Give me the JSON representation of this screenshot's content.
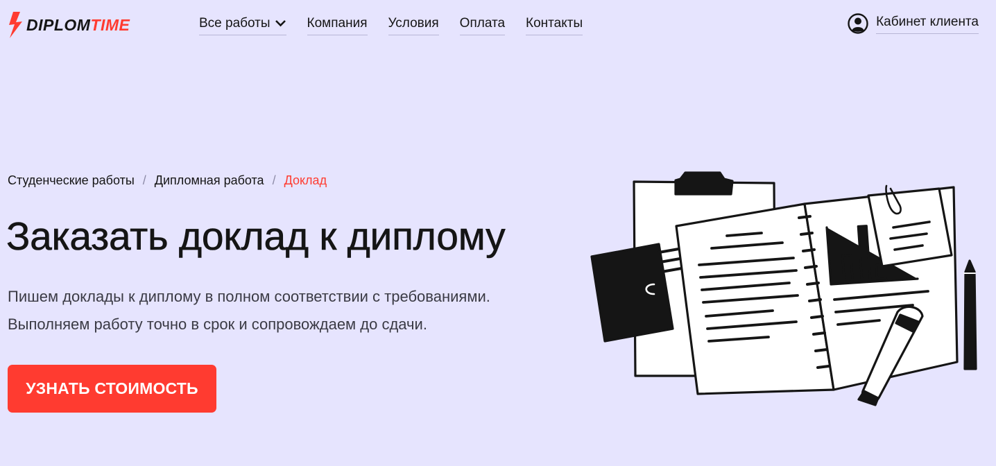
{
  "brand": {
    "logo_dark": "DIPLOM",
    "logo_red": "TIME",
    "accent_color": "#ff3b30",
    "background_color": "#e6e4fe"
  },
  "nav": {
    "items": [
      {
        "label": "Все работы",
        "has_dropdown": true
      },
      {
        "label": "Компания"
      },
      {
        "label": "Условия"
      },
      {
        "label": "Оплата"
      },
      {
        "label": "Контакты"
      }
    ],
    "cabinet_label": "Кабинет клиента",
    "cabinet_icon": "user-icon"
  },
  "breadcrumb": {
    "items": [
      "Студенческие работы",
      "Дипломная работа",
      "Доклад"
    ],
    "separator": "/"
  },
  "hero": {
    "title": "Заказать доклад к диплому",
    "description_line1": "Пишем доклады к диплому в полном соответствии с требованиями.",
    "description_line2": "Выполняем работу точно в срок и сопровождаем до сдачи.",
    "cta_label": "УЗНАТЬ СТОИМОСТЬ"
  }
}
